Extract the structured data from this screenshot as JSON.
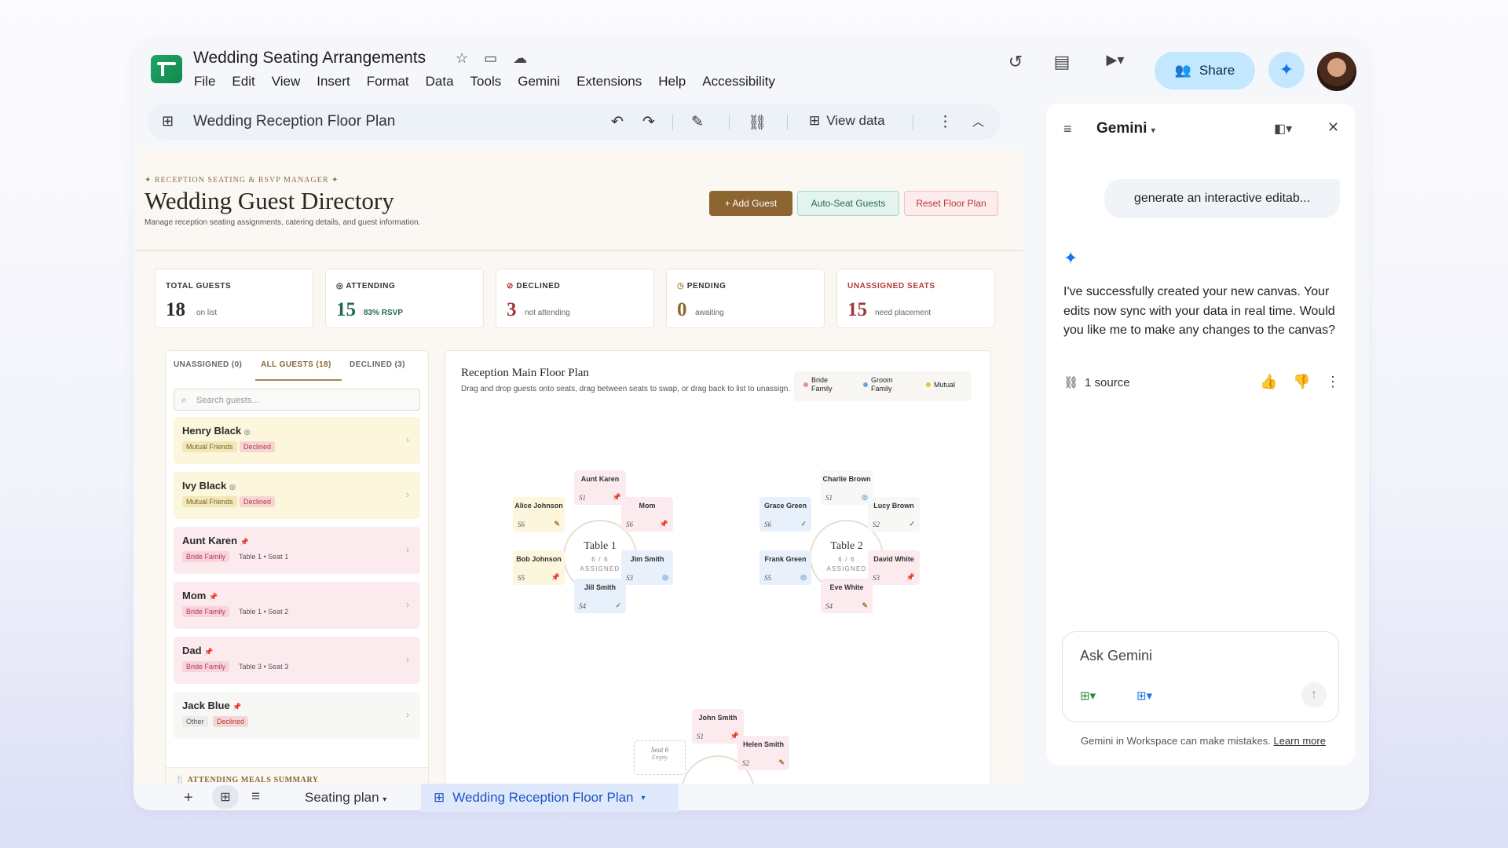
{
  "app": {
    "doc_title": "Wedding Seating Arrangements",
    "menu": [
      "File",
      "Edit",
      "View",
      "Insert",
      "Format",
      "Data",
      "Tools",
      "Gemini",
      "Extensions",
      "Help",
      "Accessibility"
    ],
    "share_label": "Share"
  },
  "toolbar": {
    "title": "Wedding Reception Floor Plan",
    "view_data_label": "View data"
  },
  "canvas": {
    "eyebrow": "✦ RECEPTION SEATING & RSVP MANAGER ✦",
    "title": "Wedding Guest Directory",
    "subtitle": "Manage reception seating assignments, catering details, and guest information.",
    "buttons": {
      "add": "+ Add Guest",
      "auto": "Auto-Seat Guests",
      "reset": "Reset Floor Plan"
    },
    "stats": [
      {
        "label": "TOTAL GUESTS",
        "value": "18",
        "caption": "on list",
        "color": "#2b2b2b",
        "label_color": "#333333",
        "icon": ""
      },
      {
        "label": "ATTENDING",
        "value": "15",
        "caption": "83% RSVP",
        "color": "#1f6b4a",
        "label_color": "#333333",
        "icon": "◎"
      },
      {
        "label": "DECLINED",
        "value": "3",
        "caption": "not attending",
        "color": "#a23535",
        "label_color": "#333333",
        "icon": "⊘"
      },
      {
        "label": "PENDING",
        "value": "0",
        "caption": "awaiting",
        "color": "#8a6a2a",
        "label_color": "#333333",
        "icon": "◷"
      },
      {
        "label": "UNASSIGNED SEATS",
        "value": "15",
        "caption": "need placement",
        "color": "#a23535",
        "label_color": "#b23a3a",
        "icon": ""
      }
    ],
    "tabs": [
      "UNASSIGNED (0)",
      "ALL GUESTS (18)",
      "DECLINED (3)"
    ],
    "search_placeholder": "Search guests...",
    "guests": [
      {
        "name": "Henry Black",
        "group": "Mutual Friends",
        "status": "Declined",
        "bg": "#fbf6dc"
      },
      {
        "name": "Ivy Black",
        "group": "Mutual Friends",
        "status": "Declined",
        "bg": "#fbf6dc"
      },
      {
        "name": "Aunt Karen",
        "group": "Bride Family",
        "status": "Table 1 • Seat 1",
        "bg": "#fcebee"
      },
      {
        "name": "Mom",
        "group": "Bride Family",
        "status": "Table 1 • Seat 2",
        "bg": "#fcebee"
      },
      {
        "name": "Dad",
        "group": "Bride Family",
        "status": "Table 3 • Seat 3",
        "bg": "#fcebee"
      },
      {
        "name": "Jack Blue",
        "group": "Other",
        "status": "Declined",
        "bg": "#f7f7f6"
      }
    ],
    "meals_summary": "🍴 ATTENDING MEALS SUMMARY",
    "floor": {
      "title": "Reception Main Floor Plan",
      "desc": "Drag and drop guests onto seats, drag between seats to swap, or drag back to list to unassign.",
      "legend": [
        {
          "label": "Bride Family",
          "color": "#e88a9e"
        },
        {
          "label": "Groom Family",
          "color": "#6fa3d6"
        },
        {
          "label": "Mutual",
          "color": "#e8c23a"
        }
      ],
      "tables": [
        {
          "name": "Table 1",
          "count": "6 / 6",
          "status": "ASSIGNED",
          "seats": [
            {
              "name": "Aunt Karen",
              "sn": "S1",
              "side": "bride"
            },
            {
              "name": "Mom",
              "sn": "S6",
              "side": "bride"
            },
            {
              "name": "Jim Smith",
              "sn": "S3",
              "side": "groom"
            },
            {
              "name": "Jill Smith",
              "sn": "S4",
              "side": "groom"
            },
            {
              "name": "Bob Johnson",
              "sn": "S5",
              "side": "mutual"
            },
            {
              "name": "Alice Johnson",
              "sn": "S6",
              "side": "mutual"
            }
          ]
        },
        {
          "name": "Table 2",
          "count": "6 / 6",
          "status": "ASSIGNED",
          "seats": [
            {
              "name": "Charlie Brown",
              "sn": "S1",
              "side": "plain"
            },
            {
              "name": "Lucy Brown",
              "sn": "S2",
              "side": "plain"
            },
            {
              "name": "David White",
              "sn": "S3",
              "side": "bride"
            },
            {
              "name": "Eve White",
              "sn": "S4",
              "side": "bride"
            },
            {
              "name": "Frank Green",
              "sn": "S5",
              "side": "groom"
            },
            {
              "name": "Grace Green",
              "sn": "S6",
              "side": "groom"
            }
          ]
        }
      ],
      "table3_seats": [
        {
          "name": "John Smith",
          "sn": "S1",
          "side": "bride"
        },
        {
          "name": "Helen Smith",
          "sn": "S2",
          "side": "bride"
        },
        {
          "name": "Seat 6",
          "sn": "Empty",
          "side": "empty"
        }
      ]
    }
  },
  "gemini": {
    "title": "Gemini",
    "user_prompt": "generate an interactive editab...",
    "response": "I've successfully created your new canvas. Your edits now sync with your data in real time. Would you like me to make any changes to the canvas?",
    "source_label": "1 source",
    "input_placeholder": "Ask Gemini",
    "disclaimer": "Gemini in Workspace can make mistakes.",
    "learn_more": "Learn more"
  },
  "bottom": {
    "sheet_tab": "Seating plan",
    "active_tab": "Wedding Reception Floor Plan"
  },
  "colors": {
    "accent": "#1a73e8",
    "share_bg": "#c2e7ff",
    "brown": "#8a6430"
  }
}
